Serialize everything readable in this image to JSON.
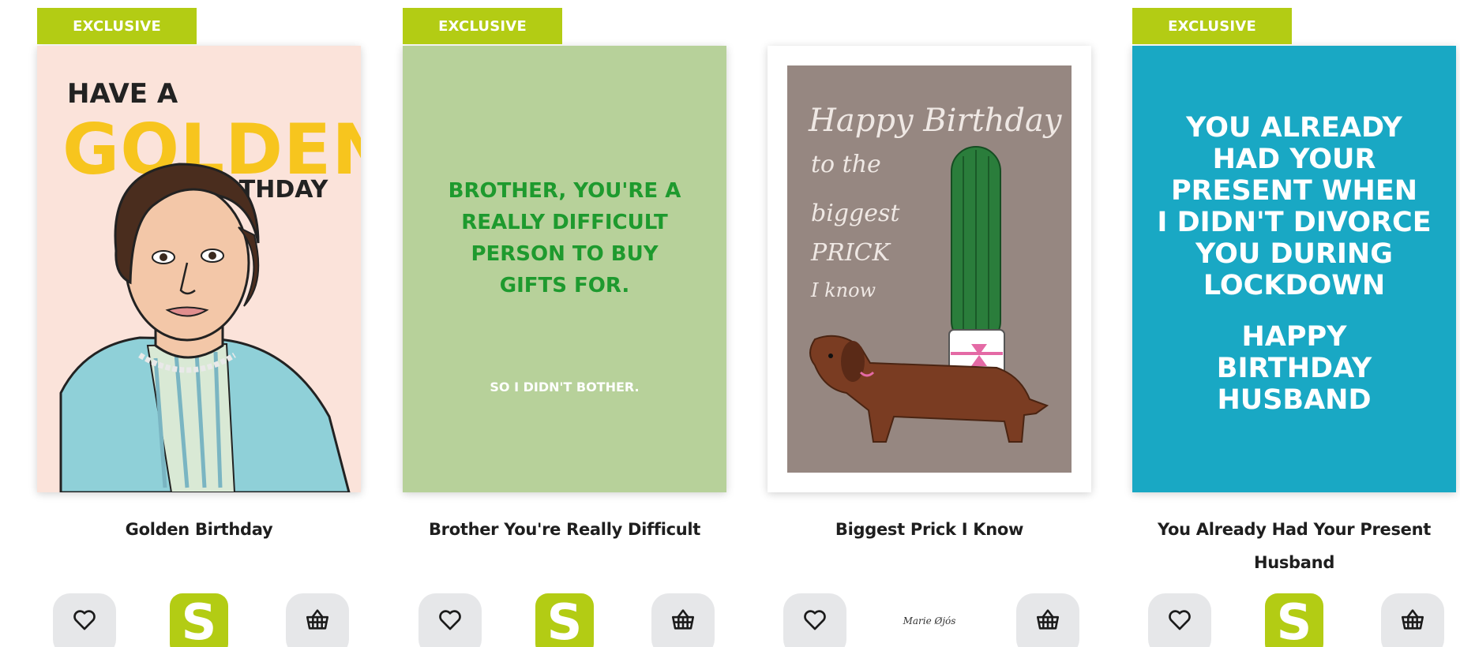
{
  "products": [
    {
      "badge": "EXCLUSIVE",
      "title": "Golden Birthday",
      "card_text": {
        "line1": "HAVE A",
        "line2": "GOLDEN",
        "line3": "BIRTHDAY"
      },
      "brand": {
        "type": "logo",
        "letter": "S"
      }
    },
    {
      "badge": "EXCLUSIVE",
      "title": "Brother You're Really Difficult",
      "card_text": {
        "line1": "BROTHER, YOU'RE A",
        "line2": "REALLY DIFFICULT",
        "line3": "PERSON TO BUY",
        "line4": "GIFTS FOR.",
        "line5": "SO I DIDN'T BOTHER."
      },
      "brand": {
        "type": "logo",
        "letter": "S"
      }
    },
    {
      "badge": "",
      "title": "Biggest Prick I Know",
      "card_text": {
        "line1": "Happy Birthday",
        "line2": "to the",
        "line3": "biggest",
        "line4": "PRICK",
        "line5": "I know"
      },
      "brand": {
        "type": "script",
        "name": "Marie Øjós"
      }
    },
    {
      "badge": "EXCLUSIVE",
      "title_line1": "You Already Had Your Present",
      "title_line2": "Husband",
      "card_text": {
        "line1": "YOU ALREADY",
        "line2": "HAD YOUR",
        "line3": "PRESENT WHEN",
        "line4": "I DIDN'T DIVORCE",
        "line5": "YOU DURING",
        "line6": "LOCKDOWN",
        "line7": "HAPPY",
        "line8": "BIRTHDAY",
        "line9": "HUSBAND"
      },
      "brand": {
        "type": "logo",
        "letter": "S"
      }
    }
  ],
  "icons": {
    "wishlist": "heart-outline-icon",
    "basket": "basket-icon"
  },
  "colors": {
    "accent": "#b3cc14",
    "button_bg": "#e6e7e9",
    "card1_bg": "#fbe3da",
    "card2_bg": "#b7d19a",
    "card3_bg": "#968781",
    "card4_bg": "#19a8c4"
  }
}
